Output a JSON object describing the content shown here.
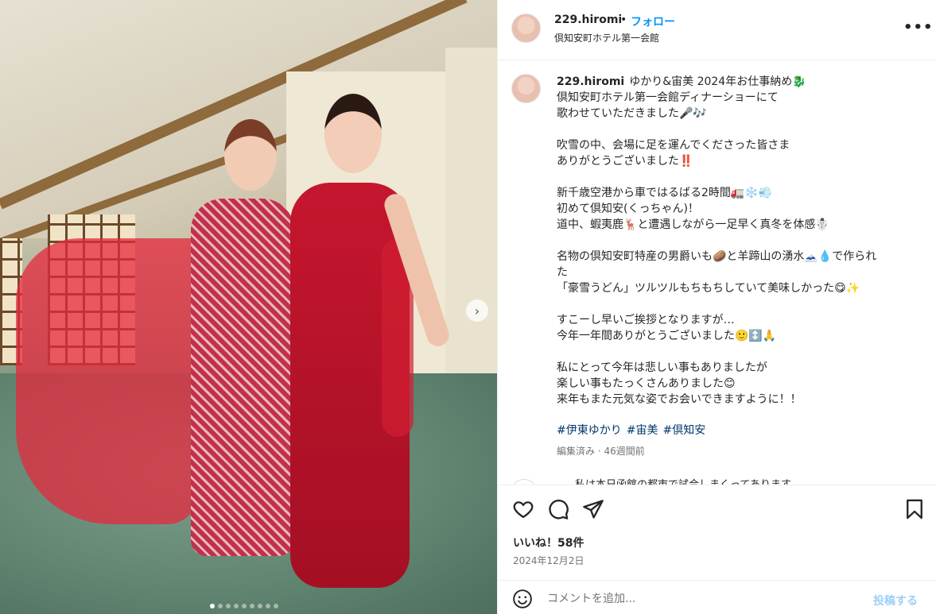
{
  "header": {
    "username": "229.hiromi",
    "separator": "•",
    "follow_label": "フォロー",
    "location": "倶知安町ホテル第一会館",
    "more_label": "•••"
  },
  "caption": {
    "username": "229.hiromi",
    "first_line": "ゆかり&宙美 2024年お仕事納め🐉",
    "lines": [
      "倶知安町ホテル第一会館ディナーショーにて",
      "歌わせていただきました🎤🎶",
      "",
      "吹雪の中、会場に足を運んでくださった皆さま",
      "ありがとうございました‼️",
      "",
      "新千歳空港から車ではるばる2時間🚛❄️💨",
      "初めて倶知安(くっちゃん)！",
      "道中、蝦夷鹿🦌と遭遇しながら一足早く真冬を体感☃️",
      "",
      "名物の倶知安町特産の男爵いも🥔と羊蹄山の湧水🗻💧で作られ",
      "た",
      "「豪雪うどん」ツルツルもちもちしていて美味しかった😋✨",
      "",
      "すこーし早いご挨拶となりますが…",
      "今年一年間ありがとうございました🙂↕️🙏",
      "",
      "私にとって今年は悲しい事もありましたが",
      "楽しい事もたっくさんありました😊",
      "来年もまた元気な姿でお会いできますように！！"
    ],
    "hashtags": [
      "#伊東ゆかり",
      "#宙美",
      "#倶知安"
    ],
    "meta": "編集済み · 46週間前"
  },
  "next_comment": {
    "text": "私は本日函館の都市で試合しまくってあります"
  },
  "actions": {
    "likes": "いいね！58件",
    "date": "2024年12月2日"
  },
  "comment_bar": {
    "placeholder": "コメントを追加...",
    "post_label": "投稿する"
  },
  "carousel": {
    "next_label": "›",
    "total_slides": 9,
    "active_slide": 1
  },
  "icons": {
    "like": "heart-icon",
    "comment": "comment-icon",
    "share": "paper-plane-icon",
    "save": "bookmark-icon",
    "emoji": "smiley-icon"
  },
  "colors": {
    "link_blue": "#0095f6",
    "hashtag": "#00376b",
    "muted": "#737373",
    "post_disabled": "#9ecff7"
  }
}
